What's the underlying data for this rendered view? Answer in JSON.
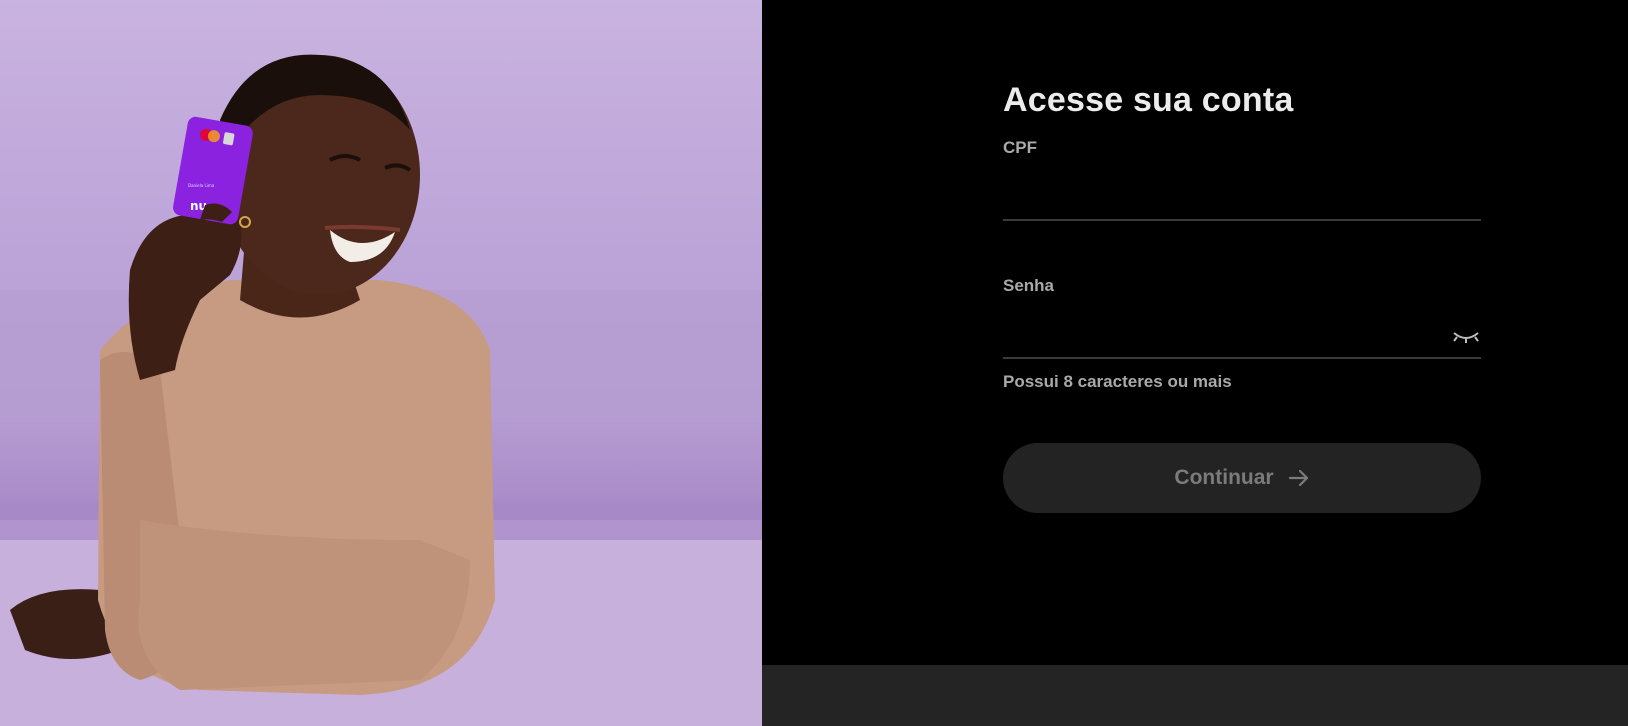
{
  "hero": {
    "image": "woman-holding-purple-card-photo",
    "card_brand_text": "nu",
    "card_name_text": "Daniela Lima",
    "background_color": "#c3acdc",
    "card_color": "#8a22e0"
  },
  "login": {
    "title": "Acesse sua conta",
    "cpf": {
      "label": "CPF",
      "value": ""
    },
    "password": {
      "label": "Senha",
      "value": "",
      "toggle_icon": "eye-closed-icon",
      "hint": "Possui 8 caracteres ou mais"
    },
    "continue_button": {
      "label": "Continuar",
      "icon": "arrow-right-icon"
    }
  },
  "colors": {
    "panel_bg": "#000000",
    "footer_bg": "#242424",
    "button_bg": "#232323",
    "title": "#ececec",
    "label": "#a9a9a9"
  }
}
